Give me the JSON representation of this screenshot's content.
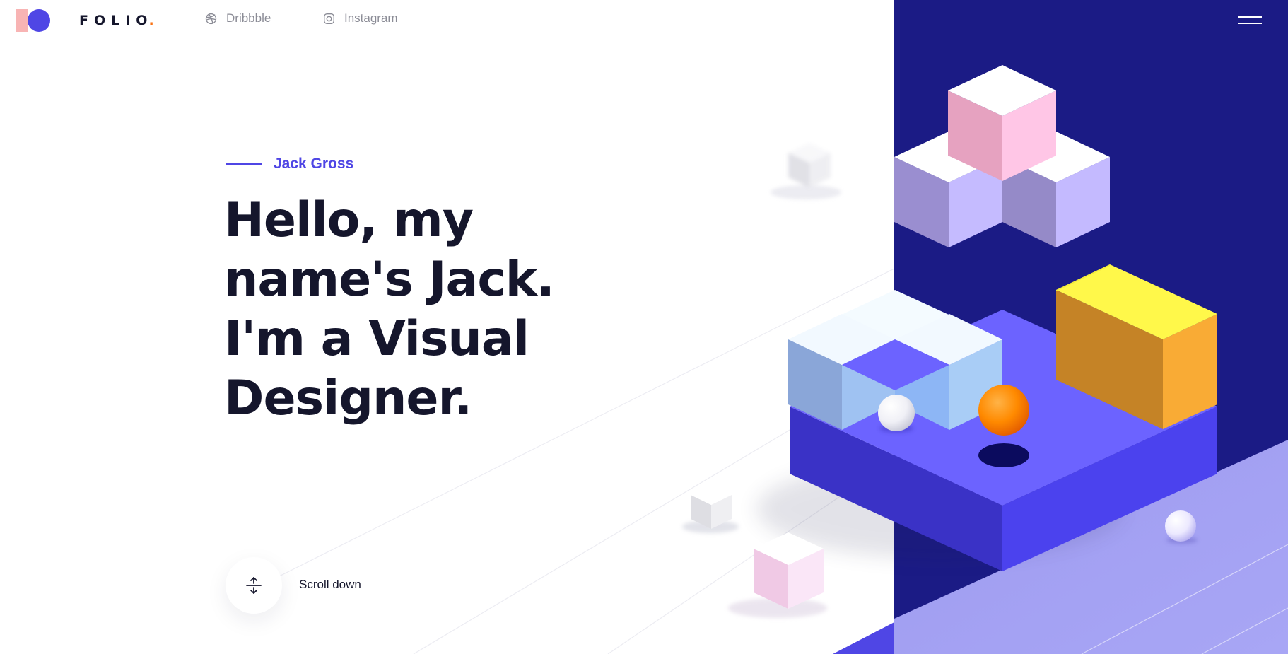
{
  "brand": {
    "name": "FOLIO",
    "dot": "."
  },
  "social": {
    "dribbble": {
      "label": "Dribbble",
      "icon": "dribbble-icon"
    },
    "instagram": {
      "label": "Instagram",
      "icon": "instagram-icon"
    }
  },
  "menu": {
    "icon": "hamburger-icon"
  },
  "hero": {
    "eyebrow": "Jack Gross",
    "title_lines": [
      "Hello, my",
      "name's Jack.",
      "I'm a Visual",
      "Designer."
    ]
  },
  "scroll": {
    "label": "Scroll down",
    "icon": "expand-vertical-icon"
  },
  "colors": {
    "accent": "#4f46e5",
    "navy": "#1b1b85",
    "text_dark": "#15162c",
    "muted": "#8b8c96",
    "logo_pink": "#f8b4b4",
    "logo_dot": "#f97316"
  }
}
